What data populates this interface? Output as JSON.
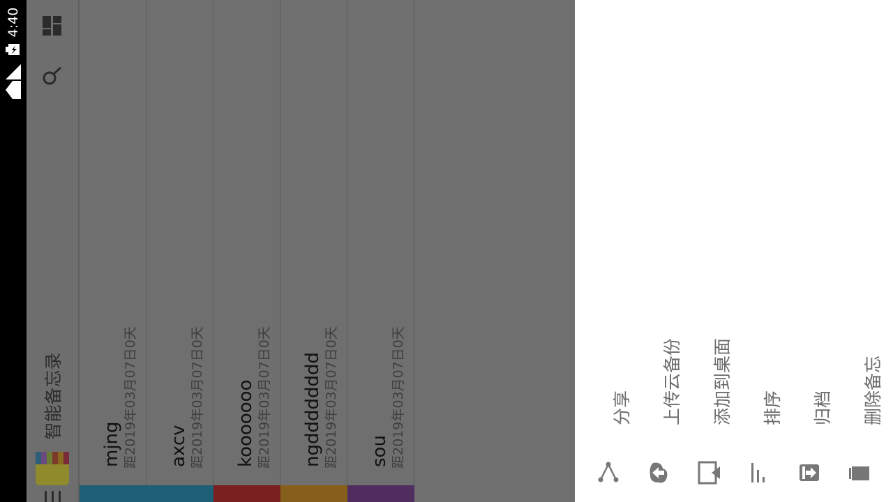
{
  "status_bar": {
    "time": "4:40"
  },
  "app": {
    "title": "智能备忘录"
  },
  "notes": [
    {
      "title": "mjng",
      "subtitle": "距2019年03月07日0天",
      "color": "#1f5f76"
    },
    {
      "title": "axcv",
      "subtitle": "距2019年03月07日0天",
      "color": "#1f5f76"
    },
    {
      "title": "kooooooo",
      "subtitle": "距2019年03月07日0天",
      "color": "#7a2020"
    },
    {
      "title": "ngdddddddd",
      "subtitle": "距2019年03月07日0天",
      "color": "#86601a"
    },
    {
      "title": "sou",
      "subtitle": "距2019年03月07日0天",
      "color": "#4f2d5e"
    }
  ],
  "menu": {
    "items": [
      {
        "label": "分享",
        "icon": "share-icon"
      },
      {
        "label": "上传云备份",
        "icon": "cloud-upload-icon"
      },
      {
        "label": "添加到桌面",
        "icon": "add-to-desktop-icon"
      },
      {
        "label": "排序",
        "icon": "sort-icon"
      },
      {
        "label": "归档",
        "icon": "archive-icon"
      },
      {
        "label": "删除备忘",
        "icon": "delete-icon"
      }
    ]
  }
}
